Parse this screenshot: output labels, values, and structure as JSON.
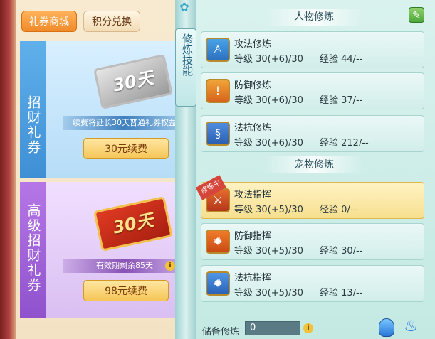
{
  "left": {
    "tabs": [
      "礼券商城",
      "积分兑换"
    ],
    "card1": {
      "title": "招财礼券",
      "ticket_text": "30天",
      "note": "续费将延长30天普通礼券权益",
      "button": "30元续费"
    },
    "card2": {
      "title": "高级招财礼券",
      "ticket_text": "30天",
      "note": "有效期剩余85天",
      "button": "98元续费"
    }
  },
  "divider": {
    "tag": "修炼技能"
  },
  "right": {
    "section_character": "人物修炼",
    "section_pet": "宠物修炼",
    "character_skills": [
      {
        "name": "攻法修炼",
        "level": "等级 30(+6)/30",
        "exp": "经验 44/--"
      },
      {
        "name": "防御修炼",
        "level": "等级 30(+6)/30",
        "exp": "经验 37/--"
      },
      {
        "name": "法抗修炼",
        "level": "等级 30(+6)/30",
        "exp": "经验 212/--"
      }
    ],
    "pet_skills": [
      {
        "name": "攻法指挥",
        "level": "等级 30(+5)/30",
        "exp": "经验 0/--",
        "badge": "修炼中"
      },
      {
        "name": "防御指挥",
        "level": "等级 30(+5)/30",
        "exp": "经验 30/--"
      },
      {
        "name": "法抗指挥",
        "level": "等级 30(+5)/30",
        "exp": "经验 13/--"
      }
    ],
    "reserve": {
      "label": "储备修炼",
      "value": "0"
    }
  },
  "icons": {
    "edit": "edit-icon",
    "info": "info-icon",
    "potion": "potion-icon",
    "flame": "flame-icon"
  }
}
